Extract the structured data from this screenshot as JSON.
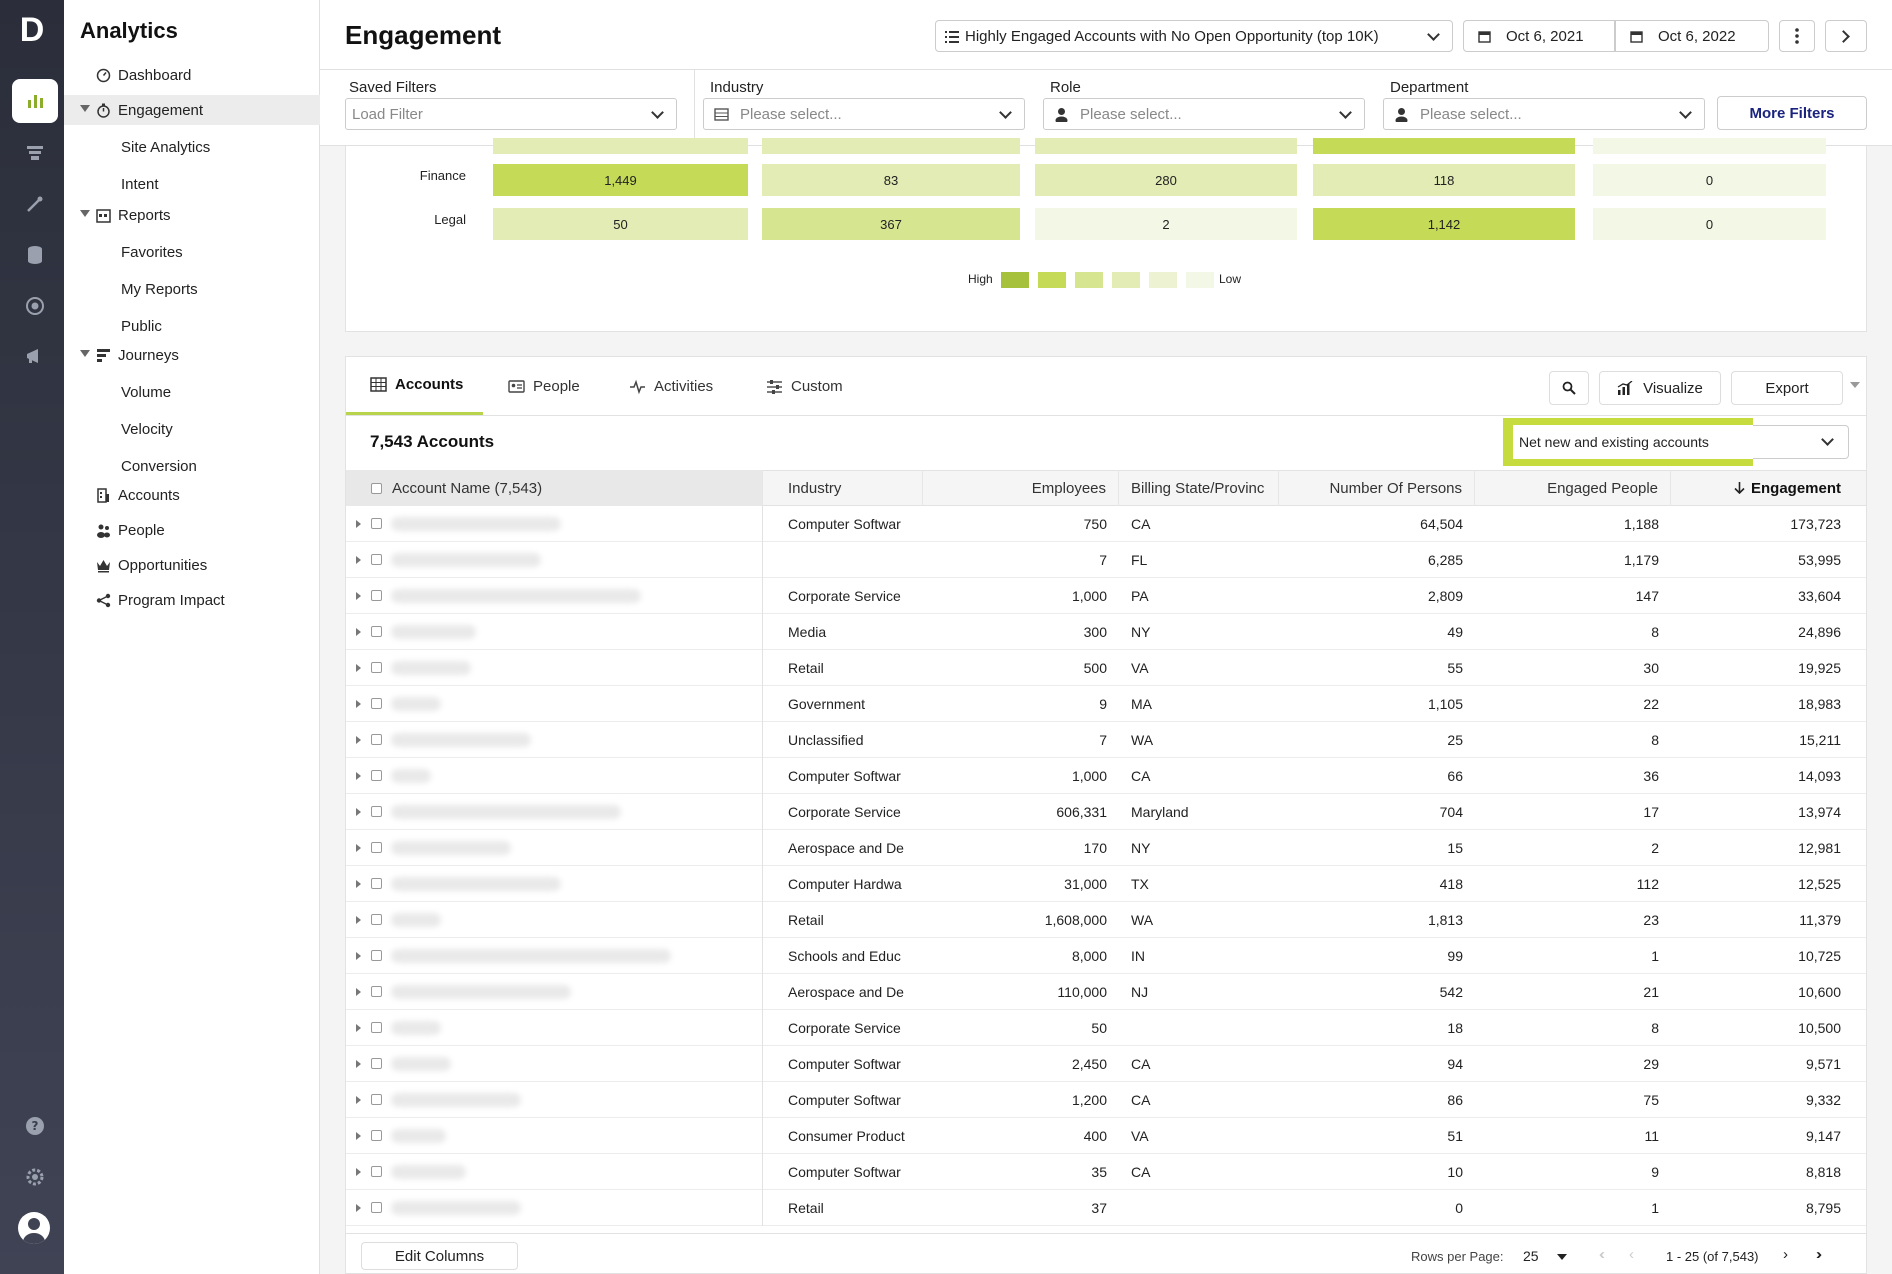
{
  "sidebar": {
    "app_title": "Analytics",
    "items": [
      {
        "label": "Dashboard"
      },
      {
        "label": "Engagement"
      },
      {
        "label": "Site Analytics"
      },
      {
        "label": "Intent"
      },
      {
        "label": "Reports"
      },
      {
        "label": "Favorites"
      },
      {
        "label": "My Reports"
      },
      {
        "label": "Public"
      },
      {
        "label": "Journeys"
      },
      {
        "label": "Volume"
      },
      {
        "label": "Velocity"
      },
      {
        "label": "Conversion"
      },
      {
        "label": "Accounts"
      },
      {
        "label": "People"
      },
      {
        "label": "Opportunities"
      },
      {
        "label": "Program Impact"
      }
    ]
  },
  "header": {
    "title": "Engagement",
    "segment": "Highly Engaged Accounts with No Open Opportunity (top 10K)",
    "date_start": "Oct 6, 2021",
    "date_end": "Oct 6, 2022"
  },
  "filters": {
    "saved": {
      "label": "Saved Filters",
      "placeholder": "Load Filter"
    },
    "industry": {
      "label": "Industry",
      "placeholder": "Please select..."
    },
    "role": {
      "label": "Role",
      "placeholder": "Please select..."
    },
    "department": {
      "label": "Department",
      "placeholder": "Please select..."
    },
    "more": "More Filters"
  },
  "heatmap": {
    "rows": [
      {
        "label": "Finance",
        "cells": [
          "1,449",
          "83",
          "280",
          "118",
          "0"
        ]
      },
      {
        "label": "Legal",
        "cells": [
          "50",
          "367",
          "2",
          "1,142",
          "0"
        ]
      }
    ],
    "legend_high": "High",
    "legend_low": "Low",
    "colors": {
      "level5": "#a6c13c",
      "level4": "#c5db58",
      "level3": "#d6e690",
      "level2": "#e2ecb4",
      "level1": "#ecf2d2",
      "level0": "#f3f7e6"
    }
  },
  "table": {
    "tabs": [
      "Accounts",
      "People",
      "Activities",
      "Custom"
    ],
    "buttons": {
      "visualize": "Visualize",
      "export": "Export"
    },
    "count_label": "7,543 Accounts",
    "account_type": "Net new and existing accounts",
    "columns": [
      "Account Name (7,543)",
      "Industry",
      "Employees",
      "Billing State/Provinc",
      "Number Of Persons",
      "Engaged People",
      "Engagement"
    ],
    "rows": [
      {
        "industry": "Computer Softwar",
        "employees": "750",
        "state": "CA",
        "persons": "64,504",
        "engaged": "1,188",
        "engagement": "173,723"
      },
      {
        "industry": "",
        "employees": "7",
        "state": "FL",
        "persons": "6,285",
        "engaged": "1,179",
        "engagement": "53,995"
      },
      {
        "industry": "Corporate Service",
        "employees": "1,000",
        "state": "PA",
        "persons": "2,809",
        "engaged": "147",
        "engagement": "33,604"
      },
      {
        "industry": "Media",
        "employees": "300",
        "state": "NY",
        "persons": "49",
        "engaged": "8",
        "engagement": "24,896"
      },
      {
        "industry": "Retail",
        "employees": "500",
        "state": "VA",
        "persons": "55",
        "engaged": "30",
        "engagement": "19,925"
      },
      {
        "industry": "Government",
        "employees": "9",
        "state": "MA",
        "persons": "1,105",
        "engaged": "22",
        "engagement": "18,983"
      },
      {
        "industry": "Unclassified",
        "employees": "7",
        "state": "WA",
        "persons": "25",
        "engaged": "8",
        "engagement": "15,211"
      },
      {
        "industry": "Computer Softwar",
        "employees": "1,000",
        "state": "CA",
        "persons": "66",
        "engaged": "36",
        "engagement": "14,093"
      },
      {
        "industry": "Corporate Service",
        "employees": "606,331",
        "state": "Maryland",
        "persons": "704",
        "engaged": "17",
        "engagement": "13,974"
      },
      {
        "industry": "Aerospace and De",
        "employees": "170",
        "state": "NY",
        "persons": "15",
        "engaged": "2",
        "engagement": "12,981"
      },
      {
        "industry": "Computer Hardwa",
        "employees": "31,000",
        "state": "TX",
        "persons": "418",
        "engaged": "112",
        "engagement": "12,525"
      },
      {
        "industry": "Retail",
        "employees": "1,608,000",
        "state": "WA",
        "persons": "1,813",
        "engaged": "23",
        "engagement": "11,379"
      },
      {
        "industry": "Schools and Educ",
        "employees": "8,000",
        "state": "IN",
        "persons": "99",
        "engaged": "1",
        "engagement": "10,725"
      },
      {
        "industry": "Aerospace and De",
        "employees": "110,000",
        "state": "NJ",
        "persons": "542",
        "engaged": "21",
        "engagement": "10,600"
      },
      {
        "industry": "Corporate Service",
        "employees": "50",
        "state": "",
        "persons": "18",
        "engaged": "8",
        "engagement": "10,500"
      },
      {
        "industry": "Computer Softwar",
        "employees": "2,450",
        "state": "CA",
        "persons": "94",
        "engaged": "29",
        "engagement": "9,571"
      },
      {
        "industry": "Computer Softwar",
        "employees": "1,200",
        "state": "CA",
        "persons": "86",
        "engaged": "75",
        "engagement": "9,332"
      },
      {
        "industry": "Consumer Product",
        "employees": "400",
        "state": "VA",
        "persons": "51",
        "engaged": "11",
        "engagement": "9,147"
      },
      {
        "industry": "Computer Softwar",
        "employees": "35",
        "state": "CA",
        "persons": "10",
        "engaged": "9",
        "engagement": "8,818"
      },
      {
        "industry": "Retail",
        "employees": "37",
        "state": "",
        "persons": "0",
        "engaged": "1",
        "engagement": "8,795"
      }
    ]
  },
  "footer": {
    "edit_columns": "Edit Columns",
    "rows_per_page_label": "Rows per Page:",
    "rows_per_page": "25",
    "range": "1 - 25 (of 7,543)"
  },
  "accent": "#c5db3e"
}
